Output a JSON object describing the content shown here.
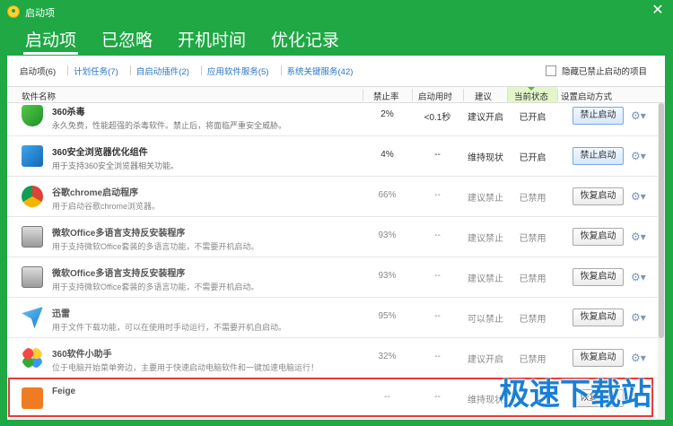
{
  "window": {
    "title": "启动项"
  },
  "main_tabs": [
    {
      "label": "启动项"
    },
    {
      "label": "已忽略"
    },
    {
      "label": "开机时间"
    },
    {
      "label": "优化记录"
    }
  ],
  "subtabs": [
    {
      "label": "启动项(6)"
    },
    {
      "label": "计划任务(7)"
    },
    {
      "label": "自启动插件(2)"
    },
    {
      "label": "应用软件服务(5)"
    },
    {
      "label": "系统关键服务(42)"
    }
  ],
  "hide_checkbox": {
    "label": "隐藏已禁止启动的项目",
    "checked": false
  },
  "columns": {
    "name": "软件名称",
    "rate": "禁止率",
    "time": "启动用时",
    "suggestion": "建议",
    "state": "当前状态",
    "settings": "设置启动方式"
  },
  "rows": [
    {
      "name": "360杀毒",
      "desc": "永久免费，性能超强的杀毒软件。禁止后，将面临严重安全威胁。",
      "rate": "2%",
      "time": "<0.1秒",
      "suggestion": "建议开启",
      "state": "已开启",
      "button": "禁止启动",
      "icon": "shield-icon"
    },
    {
      "name": "360安全浏览器优化组件",
      "desc": "用于支持360安全浏览器相关功能。",
      "rate": "4%",
      "time": "--",
      "suggestion": "维持现状",
      "state": "已开启",
      "button": "禁止启动",
      "icon": "browser-icon"
    },
    {
      "name": "谷歌chrome启动程序",
      "desc": "用于启动谷歌chrome浏览器。",
      "rate": "66%",
      "time": "--",
      "suggestion": "建议禁止",
      "state": "已禁用",
      "button": "恢复启动",
      "icon": "chrome-icon"
    },
    {
      "name": "微软Office多语言支持反安装程序",
      "desc": "用于支持微软Office套装的多语言功能，不需要开机启动。",
      "rate": "93%",
      "time": "--",
      "suggestion": "建议禁止",
      "state": "已禁用",
      "button": "恢复启动",
      "icon": "office-disk-icon"
    },
    {
      "name": "微软Office多语言支持反安装程序",
      "desc": "用于支持微软Office套装的多语言功能，不需要开机启动。",
      "rate": "93%",
      "time": "--",
      "suggestion": "建议禁止",
      "state": "已禁用",
      "button": "恢复启动",
      "icon": "office-disk-icon"
    },
    {
      "name": "迅雷",
      "desc": "用于文件下载功能，可以在使用时手动运行，不需要开机自启动。",
      "rate": "95%",
      "time": "--",
      "suggestion": "可以禁止",
      "state": "已禁用",
      "button": "恢复启动",
      "icon": "thunder-icon"
    },
    {
      "name": "360软件小助手",
      "desc": "位于电脑开始菜单旁边，主要用于快速启动电脑软件和一键加速电脑运行！",
      "rate": "32%",
      "time": "--",
      "suggestion": "建议开启",
      "state": "已禁用",
      "button": "恢复启动",
      "icon": "balls-icon"
    },
    {
      "name": "Feige",
      "desc": "",
      "rate": "--",
      "time": "--",
      "suggestion": "维持现状",
      "state": "",
      "button": "恢复启动",
      "icon": "feige-icon"
    }
  ],
  "watermark": "极速下载站",
  "colors": {
    "brand_green": "#1fa844",
    "link_blue": "#2776c8",
    "highlight_red": "#e83838"
  }
}
